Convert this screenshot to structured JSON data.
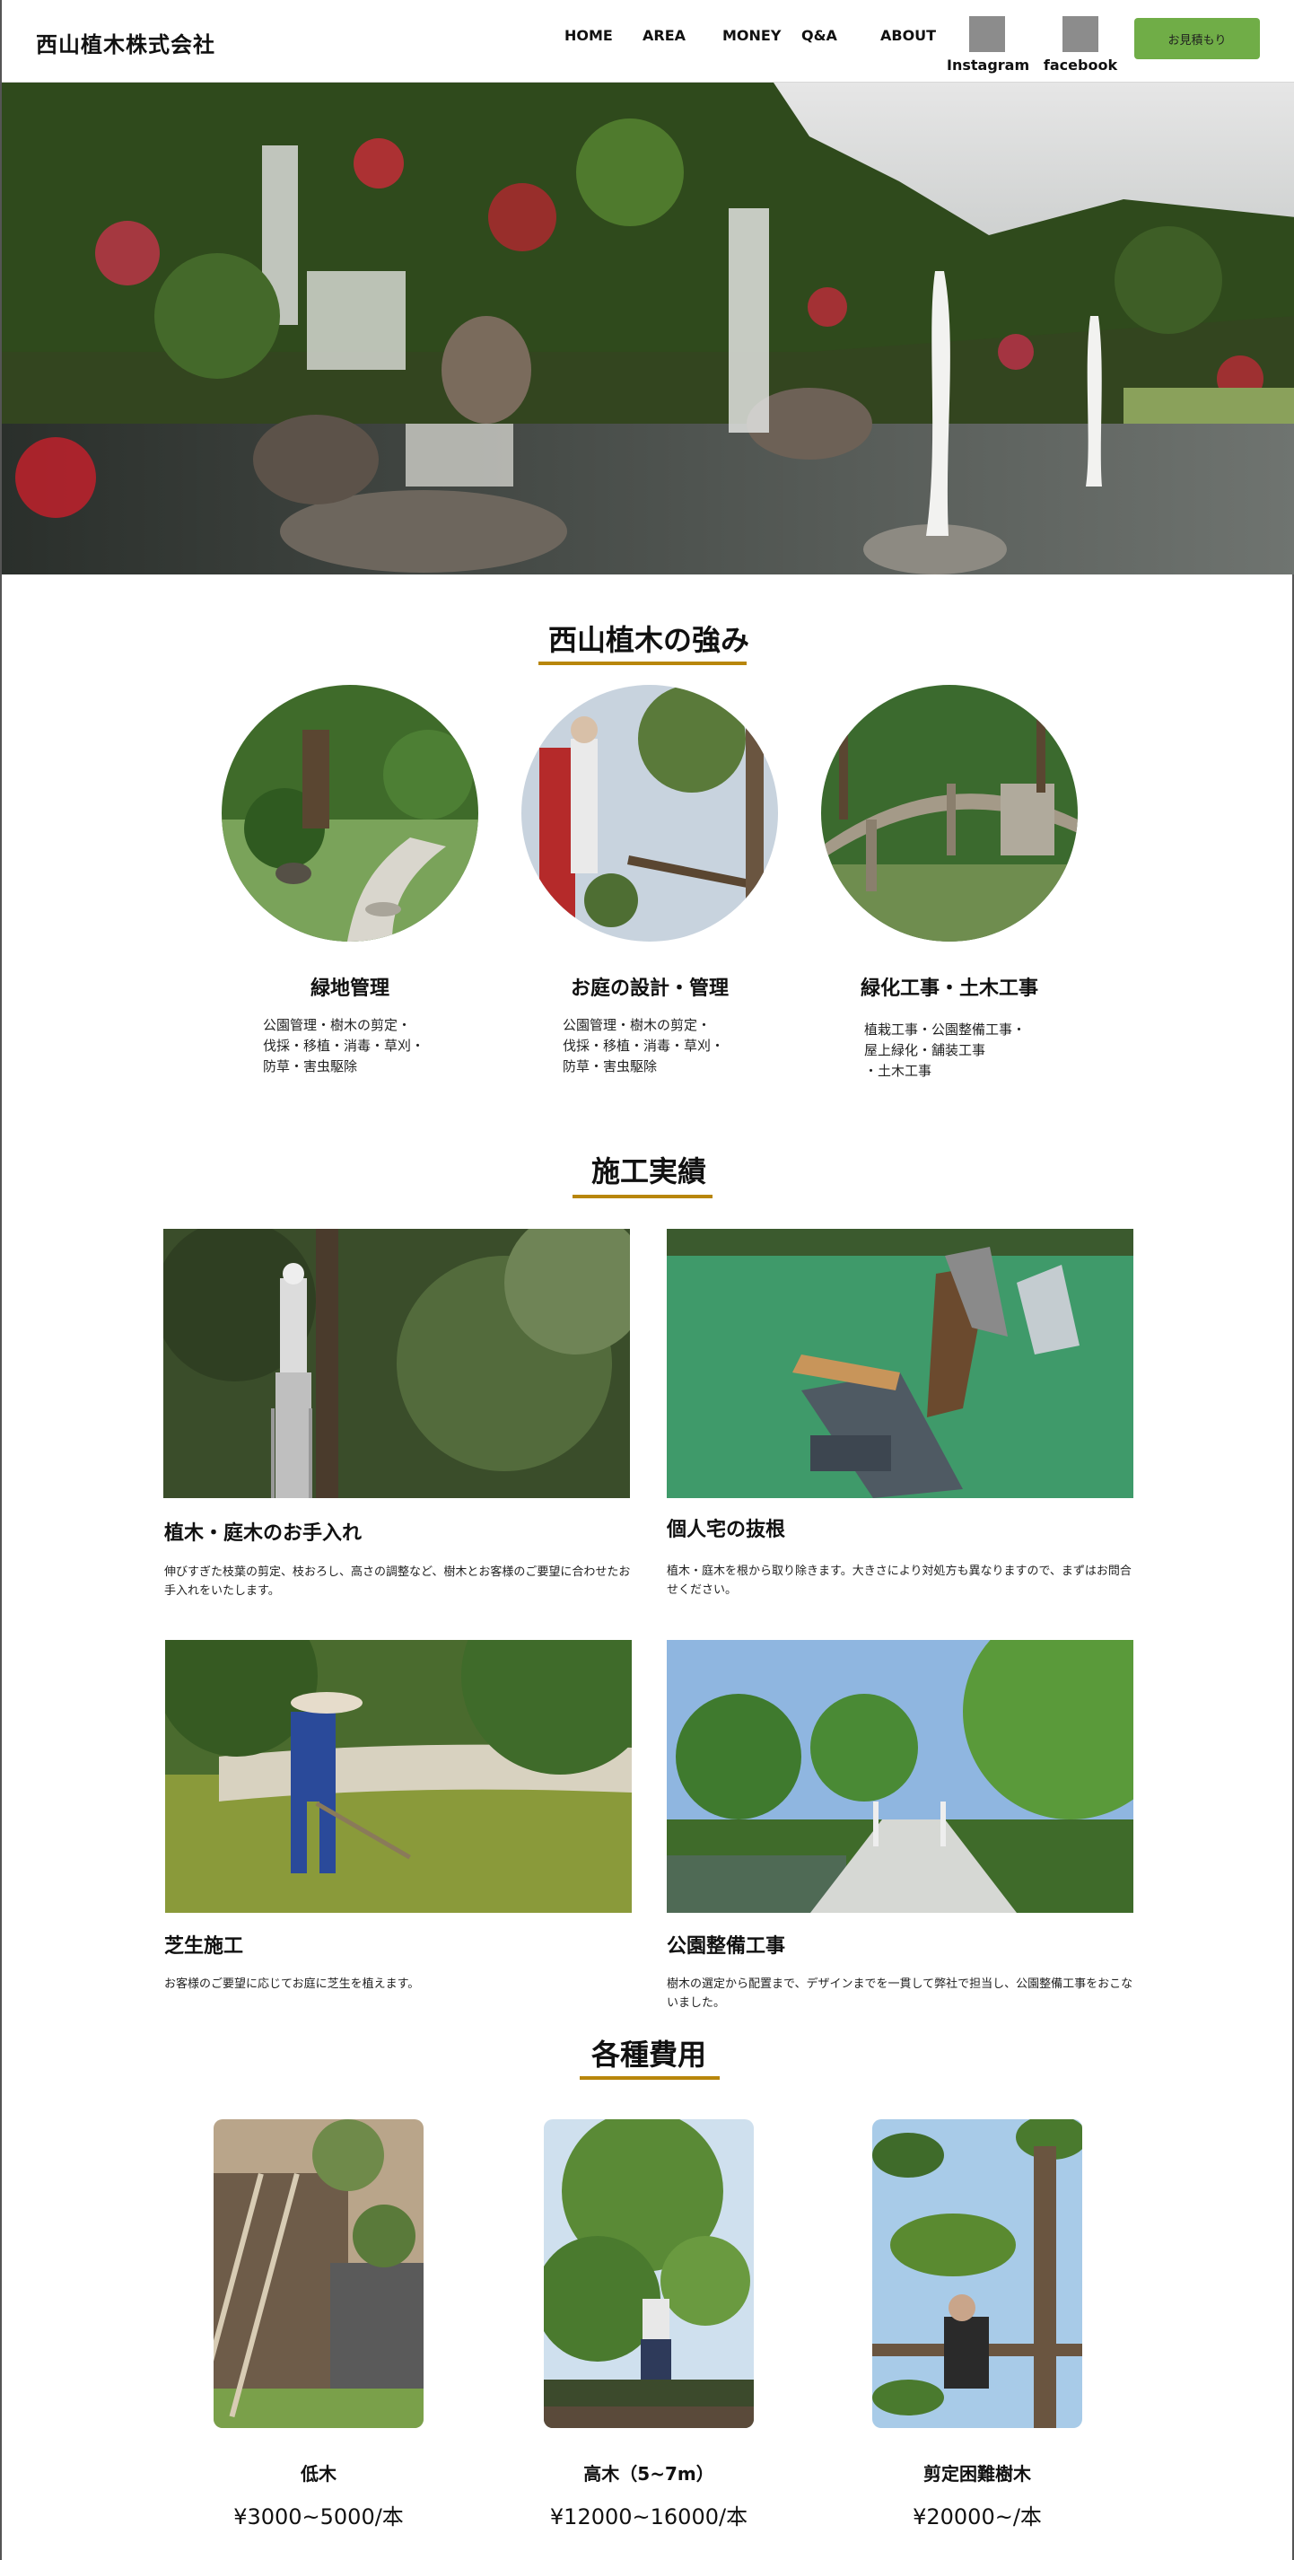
{
  "header": {
    "logo": "西山植木株式会社",
    "nav": [
      "HOME",
      "AREA",
      "MONEY",
      "Q&A",
      "ABOUT"
    ],
    "sns": [
      {
        "label": "Instagram",
        "icon": "instagram-icon"
      },
      {
        "label": "facebook",
        "icon": "facebook-icon"
      }
    ],
    "estimate_button": "お見積もり"
  },
  "colors": {
    "accent_green": "#70ad47",
    "heading_underline": "#b8860b",
    "icon_placeholder": "#8c8c8c"
  },
  "strengths": {
    "title": "西山植木の強み",
    "items": [
      {
        "name": "緑地管理",
        "desc": [
          "公園管理・樹木の剪定・",
          "伐採・移植・消毒・草刈・",
          "防草・害虫駆除"
        ]
      },
      {
        "name": "お庭の設計・管理",
        "desc": [
          "公園管理・樹木の剪定・",
          "伐採・移植・消毒・草刈・",
          "防草・害虫駆除"
        ]
      },
      {
        "name": "緑化工事・土木工事",
        "desc": [
          "植栽工事・公園整備工事・",
          "屋上緑化・舗装工事",
          "・土木工事"
        ]
      }
    ]
  },
  "works": {
    "title": "施工実績",
    "items": [
      {
        "title": "植木・庭木のお手入れ",
        "desc": "伸びすぎた枝葉の剪定、枝おろし、高さの調整など、樹木とお客様のご要望に合わせたお手入れをいたします。"
      },
      {
        "title": "個人宅の抜根",
        "desc": "植木・庭木を根から取り除きます。大きさにより対処方も異なりますので、まずはお問合せください。"
      },
      {
        "title": "芝生施工",
        "desc": "お客様のご要望に応じてお庭に芝生を植えます。"
      },
      {
        "title": "公園整備工事",
        "desc": "樹木の選定から配置まで、デザインまでを一貫して弊社で担当し、公園整備工事をおこないました。"
      }
    ]
  },
  "costs": {
    "title": "各種費用",
    "items": [
      {
        "name": "低木",
        "price": "¥3000~5000/本"
      },
      {
        "name": "高木（5~7m）",
        "price": "¥12000~16000/本"
      },
      {
        "name": "剪定困難樹木",
        "price": "¥20000~/本"
      }
    ]
  }
}
